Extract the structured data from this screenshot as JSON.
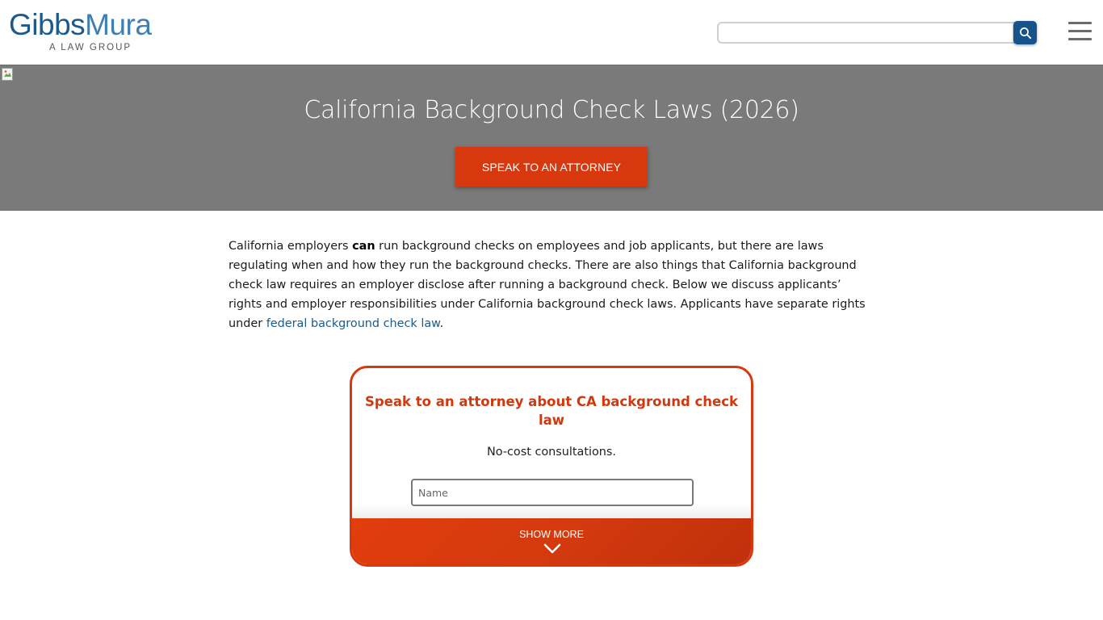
{
  "header": {
    "logo_part1": "Gibbs",
    "logo_part2": "Mura",
    "logo_tagline": "A LAW GROUP",
    "search_placeholder": "",
    "search_icon": "search-icon",
    "menu_icon": "hamburger-menu-icon"
  },
  "hero": {
    "title": "California Background Check Laws (2026)",
    "cta_label": "SPEAK TO AN ATTORNEY",
    "background_color": "#7a7a7a",
    "cta_color": "#d7380e"
  },
  "intro": {
    "text_1": "California employers ",
    "bold": "can",
    "text_2": " run background checks on employees and job applicants, but there are laws regulating when and how they run the background checks. There are also things that California background check law requires an employer disclose after running a background check. Below we discuss applicants’ rights and employer responsibilities under California background check laws. Applicants have separate rights under ",
    "link": "federal background check law",
    "text_3": "."
  },
  "form_card": {
    "title": "Speak to an attorney about CA background check law",
    "subtitle": "No-cost consultations.",
    "name_placeholder": "Name",
    "show_more_label": "SHOW MORE",
    "accent_color": "#d7380e"
  },
  "colors": {
    "brand_blue": "#1b5a8a",
    "brand_orange": "#d7380e"
  }
}
